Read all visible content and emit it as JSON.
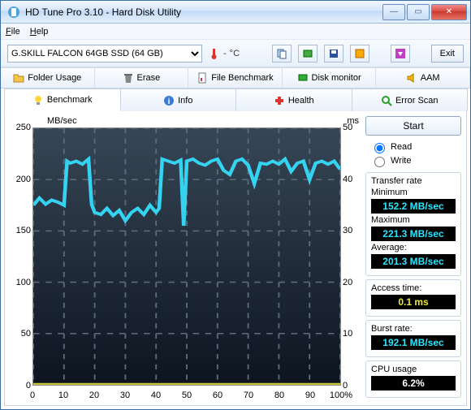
{
  "window": {
    "title": "HD Tune Pro 3.10 - Hard Disk Utility"
  },
  "menu": {
    "file": "File",
    "help": "Help"
  },
  "toolbar": {
    "drive": "G.SKILL FALCON 64GB SSD (64 GB)",
    "temp_unit": "°C",
    "exit": "Exit"
  },
  "tabs_row1": {
    "folder_usage": "Folder Usage",
    "erase": "Erase",
    "file_benchmark": "File Benchmark",
    "disk_monitor": "Disk monitor",
    "aam": "AAM"
  },
  "tabs_row2": {
    "benchmark": "Benchmark",
    "info": "Info",
    "health": "Health",
    "error_scan": "Error Scan"
  },
  "side": {
    "start": "Start",
    "read": "Read",
    "write": "Write",
    "transfer_rate": "Transfer rate",
    "minimum": "Minimum",
    "minimum_val": "152.2 MB/sec",
    "maximum": "Maximum",
    "maximum_val": "221.3 MB/sec",
    "average": "Average:",
    "average_val": "201.3 MB/sec",
    "access_time": "Access time:",
    "access_time_val": "0.1 ms",
    "burst_rate": "Burst rate:",
    "burst_rate_val": "192.1 MB/sec",
    "cpu_usage": "CPU usage",
    "cpu_usage_val": "6.2%"
  },
  "chart_data": {
    "type": "line",
    "title": "",
    "xlabel": "%",
    "ylabel_left": "MB/sec",
    "ylabel_right": "ms",
    "xlim": [
      0,
      100
    ],
    "ylim_left": [
      0,
      250
    ],
    "ylim_right": [
      0,
      50
    ],
    "x_ticks": [
      0,
      10,
      20,
      30,
      40,
      50,
      60,
      70,
      80,
      90,
      100
    ],
    "y_ticks_left": [
      0,
      50,
      100,
      150,
      200,
      250
    ],
    "y_ticks_right": [
      0,
      10,
      20,
      30,
      40,
      50
    ],
    "series": [
      {
        "name": "Transfer rate (MB/sec)",
        "axis": "left",
        "color": "#35d3f2",
        "x": [
          0,
          2,
          4,
          6,
          8,
          10,
          11,
          12,
          14,
          16,
          18,
          19,
          20,
          22,
          24,
          26,
          28,
          30,
          32,
          34,
          36,
          38,
          40,
          41,
          42,
          44,
          46,
          48,
          49,
          50,
          52,
          54,
          56,
          58,
          60,
          62,
          64,
          66,
          68,
          70,
          72,
          74,
          76,
          78,
          80,
          82,
          84,
          86,
          88,
          90,
          92,
          94,
          96,
          98,
          100
        ],
        "values": [
          175,
          182,
          176,
          180,
          178,
          175,
          218,
          216,
          218,
          215,
          220,
          176,
          168,
          166,
          172,
          165,
          170,
          160,
          168,
          172,
          166,
          175,
          168,
          172,
          220,
          218,
          216,
          219,
          155,
          218,
          220,
          216,
          214,
          218,
          220,
          209,
          205,
          218,
          220,
          214,
          196,
          216,
          215,
          218,
          215,
          220,
          208,
          216,
          218,
          200,
          216,
          218,
          215,
          218,
          210
        ]
      },
      {
        "name": "Access time (ms)",
        "axis": "right",
        "color": "#c9c635",
        "x": [
          0,
          100
        ],
        "values": [
          0.1,
          0.1
        ]
      }
    ]
  }
}
